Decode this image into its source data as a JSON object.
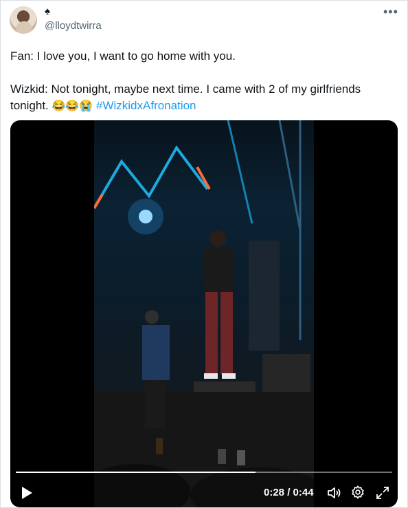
{
  "author": {
    "name_symbol": "♠",
    "handle": "@lloydtwirra",
    "more_icon": "more-horizontal-icon"
  },
  "tweet": {
    "line1": "Fan: I love you, I want to go home with you.",
    "line2": "Wizkid: Not tonight, maybe next time. I came with 2 of my girlfriends",
    "line3_prefix": "tonight.",
    "emojis": "😂😂😭",
    "hashtag": "#WizkidxAfronation"
  },
  "video": {
    "progress": 0.636,
    "time_display": "0:28 / 0:44",
    "icons": [
      "play-icon",
      "volume-icon",
      "settings-gear-icon",
      "fullscreen-icon"
    ]
  },
  "colors": {
    "link": "#1d9bf0",
    "secondary_text": "#536471",
    "video_bg": "#000000"
  }
}
